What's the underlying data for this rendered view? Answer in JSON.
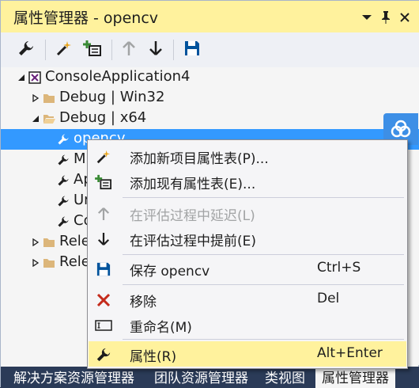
{
  "window": {
    "title": "属性管理器 - opencv",
    "dropdown_icon": "dropdown-arrow-icon",
    "pin_icon": "pin-icon",
    "close_icon": "close-icon"
  },
  "toolbar": {
    "buttons": [
      {
        "name": "properties-button",
        "icon": "wrench-icon"
      },
      {
        "name": "add-new-property-sheet-button",
        "icon": "wand-icon"
      },
      {
        "name": "add-existing-property-sheet-button",
        "icon": "add-sheet-icon"
      },
      {
        "name": "move-up-button",
        "icon": "arrow-up-icon",
        "disabled": true
      },
      {
        "name": "move-down-button",
        "icon": "arrow-down-icon"
      },
      {
        "name": "save-button",
        "icon": "floppy-icon"
      }
    ]
  },
  "tree": {
    "project": "ConsoleApplication4",
    "config_debug_win32": "Debug | Win32",
    "config_debug_x64": "Debug | x64",
    "sheets": [
      "opencv",
      "M",
      "Ap",
      "Ur",
      "Co"
    ],
    "config_release_1": "Rele",
    "config_release_2": "Rele"
  },
  "menu": {
    "add_new": "添加新项目属性表(P)...",
    "add_existing": "添加现有属性表(E)...",
    "delay": "在评估过程中延迟(L)",
    "advance": "在评估过程中提前(E)",
    "save": "保存 opencv",
    "save_key": "Ctrl+S",
    "remove": "移除",
    "remove_key": "Del",
    "rename": "重命名(M)",
    "properties": "属性(R)",
    "properties_key": "Alt+Enter"
  },
  "tabs": [
    "解决方案资源管理器",
    "团队资源管理器",
    "类视图",
    "属性管理器"
  ],
  "colors": {
    "title_bg": "#fff29d",
    "selection": "#3399ff",
    "menu_highlight": "#fff29d",
    "tab_bar": "#2b3b58"
  }
}
